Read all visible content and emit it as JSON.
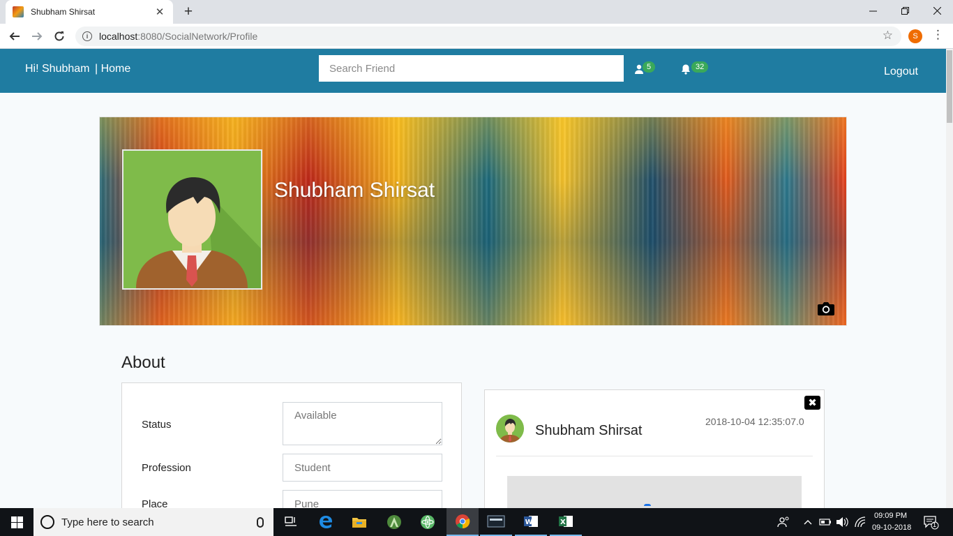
{
  "browser": {
    "tab_title": "Shubham Shirsat",
    "tab_close": "✕",
    "new_tab": "+",
    "url_host": "localhost",
    "url_path": ":8080/SocialNetwork/Profile",
    "profile_initial": "S"
  },
  "header": {
    "greeting": "Hi! Shubham",
    "home": "| Home",
    "search_placeholder": "Search Friend",
    "friend_requests_count": "5",
    "notifications_count": "32",
    "logout": "Logout"
  },
  "profile": {
    "name": "Shubham Shirsat"
  },
  "about": {
    "title": "About",
    "fields": [
      {
        "label": "Status",
        "placeholder": "Available"
      },
      {
        "label": "Profession",
        "placeholder": "Student"
      },
      {
        "label": "Place",
        "placeholder": "Pune"
      }
    ]
  },
  "post": {
    "author": "Shubham Shirsat",
    "timestamp": "2018-10-04 12:35:07.0",
    "close": "✖"
  },
  "taskbar": {
    "search_placeholder": "Type here to search",
    "time": "09:09 PM",
    "date": "09-10-2018",
    "notification_count": "1"
  },
  "colors": {
    "header_bg": "#1f7ca1",
    "badge": "#3aa95a",
    "avatar_bg": "#7fbb4a"
  }
}
